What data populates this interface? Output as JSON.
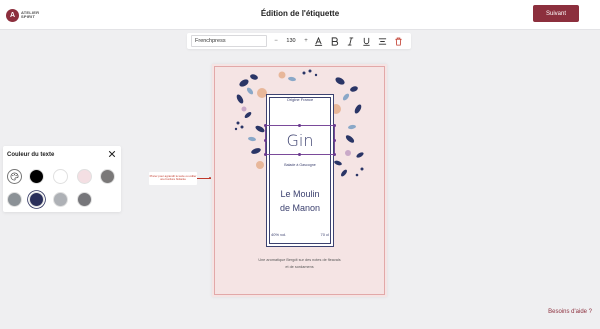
{
  "header": {
    "logo_mark": "A",
    "logo_line1": "ATELIER",
    "logo_line2": "SPIRIT",
    "title": "Édition de l'étiquette",
    "next_label": "Suivant"
  },
  "toolbar": {
    "font_value": "Frenchpress",
    "minus": "−",
    "size_value": "130",
    "plus": "+",
    "tools": [
      "text-color-icon",
      "bold-icon",
      "italic-icon",
      "underline-icon",
      "align-icon",
      "delete-icon"
    ]
  },
  "label": {
    "origin": "Origine France",
    "product": "Gin",
    "subtitle": "Balade à Gascogne",
    "name_line1": "Le Moulin",
    "name_line2": "de Manon",
    "abv": "40% vol.",
    "volume": "70 cl",
    "desc_line1": "Une aromatique Bergdt sur des notes de fleavals",
    "desc_line2": "et de sordamens"
  },
  "hint": {
    "text": "Pincer pour agrandir le texte ou éditer une bordure flottante"
  },
  "color_panel": {
    "title": "Couleur du texte",
    "swatches": [
      "#000000",
      "#ffffff",
      "#f4dfe3",
      "#7a7878",
      "#8b9196",
      "#2a2f5a",
      "#aeb1b6",
      "#76767a"
    ],
    "selected": "#2a2f5a"
  },
  "help": {
    "label": "Besoins d'aide ?"
  },
  "colors": {
    "brand": "#8c2f3d",
    "label_bg": "#f5e4e4",
    "ink": "#3d4270"
  }
}
